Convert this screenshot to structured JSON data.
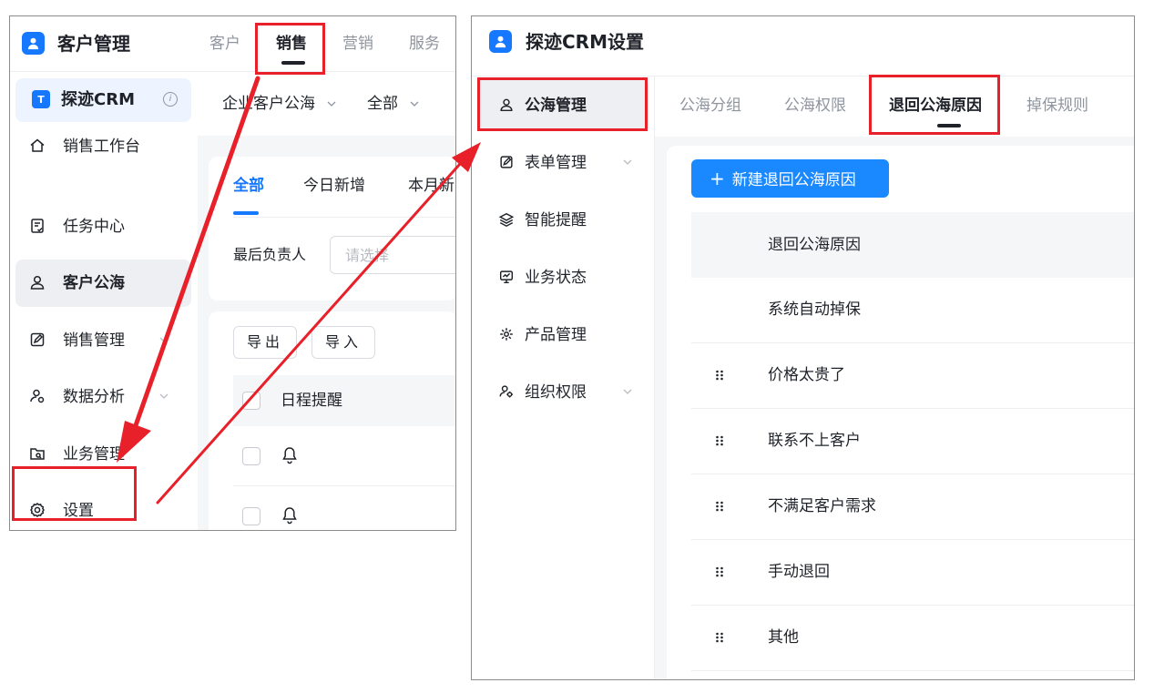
{
  "left": {
    "app_title": "客户管理",
    "top_tabs": [
      "客户",
      "销售",
      "营销",
      "服务"
    ],
    "active_top_tab": "销售",
    "brand": "探迹CRM",
    "nav": [
      {
        "label": "销售工作台",
        "icon": "home-icon"
      },
      {
        "label": "任务中心",
        "icon": "task-icon"
      },
      {
        "label": "客户公海",
        "icon": "user-icon",
        "active": true
      },
      {
        "label": "销售管理",
        "icon": "edit-icon"
      },
      {
        "label": "数据分析",
        "icon": "people-icon"
      },
      {
        "label": "业务管理",
        "icon": "folder-icon"
      },
      {
        "label": "设置",
        "icon": "gear-icon"
      }
    ],
    "filters": [
      "企业客户公海",
      "全部"
    ],
    "sub_tabs": [
      "全部",
      "今日新增",
      "本月新"
    ],
    "owner_label": "最后负责人",
    "owner_placeholder": "请选择",
    "export_label": "导出",
    "import_label": "导入",
    "table_header": "日程提醒"
  },
  "right": {
    "app_title": "探迹CRM设置",
    "nav": [
      {
        "label": "公海管理",
        "icon": "user-icon",
        "active": true
      },
      {
        "label": "表单管理",
        "icon": "form-icon"
      },
      {
        "label": "智能提醒",
        "icon": "layers-icon"
      },
      {
        "label": "业务状态",
        "icon": "monitor-icon"
      },
      {
        "label": "产品管理",
        "icon": "product-icon"
      },
      {
        "label": "组织权限",
        "icon": "org-icon"
      }
    ],
    "tabs": [
      "公海分组",
      "公海权限",
      "退回公海原因",
      "掉保规则"
    ],
    "active_tab": "退回公海原因",
    "new_button": "新建退回公海原因",
    "table_header": "退回公海原因",
    "reasons": [
      "系统自动掉保",
      "价格太贵了",
      "联系不上客户",
      "不满足客户需求",
      "手动退回",
      "其他"
    ]
  },
  "colors": {
    "accent": "#1677ff",
    "annotation": "#e8202a"
  }
}
